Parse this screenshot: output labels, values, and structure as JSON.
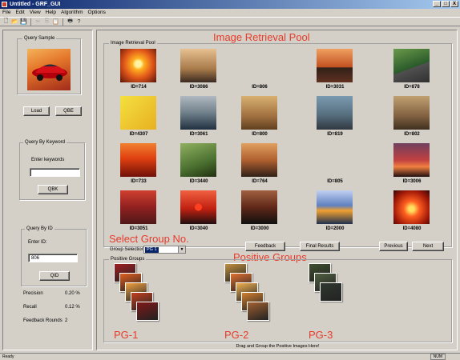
{
  "window": {
    "title": "Untitled - GRF_GUI",
    "minimize": "_",
    "maximize": "□",
    "close": "X"
  },
  "menu": [
    "File",
    "Edit",
    "View",
    "Help",
    "Algorithm",
    "Options"
  ],
  "toolbar": [
    {
      "name": "new-icon",
      "glyph": "🗋",
      "enabled": true
    },
    {
      "name": "open-icon",
      "glyph": "📂",
      "enabled": true
    },
    {
      "name": "save-icon",
      "glyph": "💾",
      "enabled": true
    },
    {
      "name": "cut-icon",
      "glyph": "✂",
      "enabled": false
    },
    {
      "name": "copy-icon",
      "glyph": "⎘",
      "enabled": false
    },
    {
      "name": "paste-icon",
      "glyph": "📋",
      "enabled": false
    },
    {
      "name": "print-icon",
      "glyph": "🖶",
      "enabled": true
    },
    {
      "name": "help-icon",
      "glyph": "?",
      "enabled": true
    }
  ],
  "left": {
    "query_sample": {
      "label": "Query Sample"
    },
    "load_label": "Load",
    "qbe_label": "QBE",
    "keyword": {
      "group_label": "Query By Keyword",
      "prompt": "Enter keywords",
      "value": "",
      "button": "QBK"
    },
    "by_id": {
      "group_label": "Query By ID",
      "prompt": "Enter ID:",
      "value": "806",
      "button": "QID"
    },
    "stats": [
      {
        "label": "Precision",
        "value": "0.20 %"
      },
      {
        "label": "Recall",
        "value": "0.12 %"
      },
      {
        "label": "Feedback Rounds",
        "value": "2"
      }
    ]
  },
  "right": {
    "annotation_title": "Image Retrieval Pool",
    "pool_label": "Image Retrieval Pool",
    "images": [
      {
        "id": "ID=714",
        "theme": "sunset"
      },
      {
        "id": "ID=3086",
        "theme": "woman"
      },
      {
        "id": "ID=806",
        "theme": "blank"
      },
      {
        "id": "ID=3031",
        "theme": "boats"
      },
      {
        "id": "ID=878",
        "theme": "redcar"
      },
      {
        "id": "ID=4307",
        "theme": "molecule"
      },
      {
        "id": "ID=3061",
        "theme": "seasky"
      },
      {
        "id": "ID=800",
        "theme": "silvercar"
      },
      {
        "id": "ID=819",
        "theme": "redcar2"
      },
      {
        "id": "ID=802",
        "theme": "redcar3"
      },
      {
        "id": "ID=733",
        "theme": "sunsetfig"
      },
      {
        "id": "ID=3440",
        "theme": "bird"
      },
      {
        "id": "ID=764",
        "theme": "beach"
      },
      {
        "id": "ID=805",
        "theme": "blank"
      },
      {
        "id": "ID=3006",
        "theme": "cloudsunset"
      },
      {
        "id": "ID=3051",
        "theme": "redcloud"
      },
      {
        "id": "ID=3040",
        "theme": "sunsea"
      },
      {
        "id": "ID=3000",
        "theme": "darksea"
      },
      {
        "id": "ID=2000",
        "theme": "bluesea"
      },
      {
        "id": "ID=4080",
        "theme": "fire"
      }
    ],
    "select_annotation": "Select Group No.",
    "group_selection_label": "Group Selection",
    "group_selection_value": "PG 1",
    "feedback_label": "Feedback",
    "final_results_label": "Final Results",
    "previous_label": "Previous",
    "next_label": "Next",
    "positive_annotation": "Positive Groups",
    "positive_groups_label": "Positive Groups",
    "groups": [
      {
        "name": "PG-1",
        "count": 5
      },
      {
        "name": "PG-2",
        "count": 5
      },
      {
        "name": "PG-3",
        "count": 3
      }
    ],
    "drag_hint": "Drag and Group the Positive Images Here!"
  },
  "status": {
    "left": "Ready",
    "right": "NUM"
  }
}
